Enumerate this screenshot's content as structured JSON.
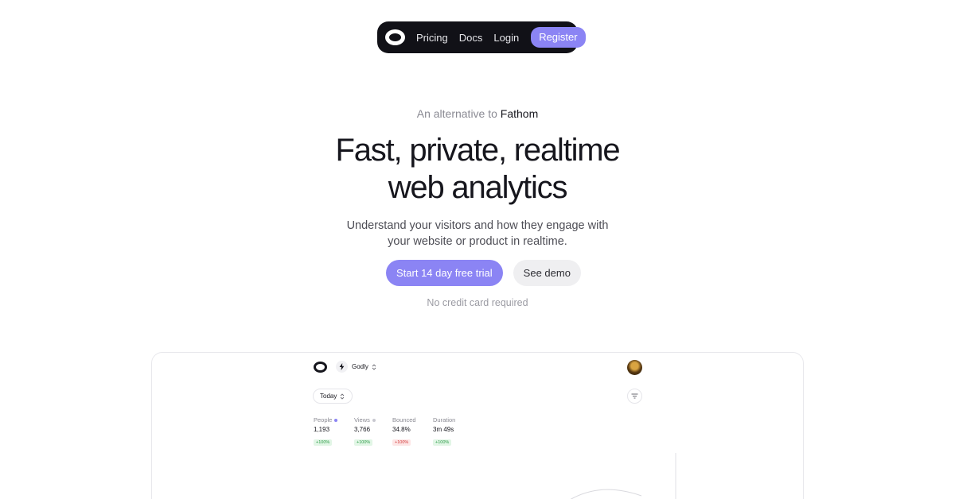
{
  "nav": {
    "links": [
      "Pricing",
      "Docs",
      "Login"
    ],
    "register_label": "Register"
  },
  "hero": {
    "eyebrow_prefix": "An alternative to",
    "eyebrow_brand": "Fathom",
    "title_line1": "Fast, private, realtime",
    "title_line2": "web analytics",
    "subtitle_line1": "Understand your visitors and how they engage with",
    "subtitle_line2": "your website or product in realtime.",
    "cta_primary": "Start 14 day free trial",
    "cta_secondary": "See demo",
    "note": "No credit card required"
  },
  "preview": {
    "site_name": "Godly",
    "range_label": "Today",
    "stats": [
      {
        "label": "People",
        "value": "1,193",
        "delta": "+100%",
        "trend": "up",
        "dot_color": "#8b84f4"
      },
      {
        "label": "Views",
        "value": "3,766",
        "delta": "+100%",
        "trend": "up",
        "dot_color": "#c8c8d0"
      },
      {
        "label": "Bounced",
        "value": "34.8%",
        "delta": "+100%",
        "trend": "down"
      },
      {
        "label": "Duration",
        "value": "3m 49s",
        "delta": "+100%",
        "trend": "up"
      }
    ]
  },
  "colors": {
    "accent": "#8b84f4",
    "nav_bg": "#111117",
    "positive": "#2a9a45",
    "negative": "#d23a3a"
  },
  "icons": [
    "logo-ring-icon",
    "bolt-icon",
    "chevron-updown-icon",
    "filter-icon",
    "avatar"
  ]
}
